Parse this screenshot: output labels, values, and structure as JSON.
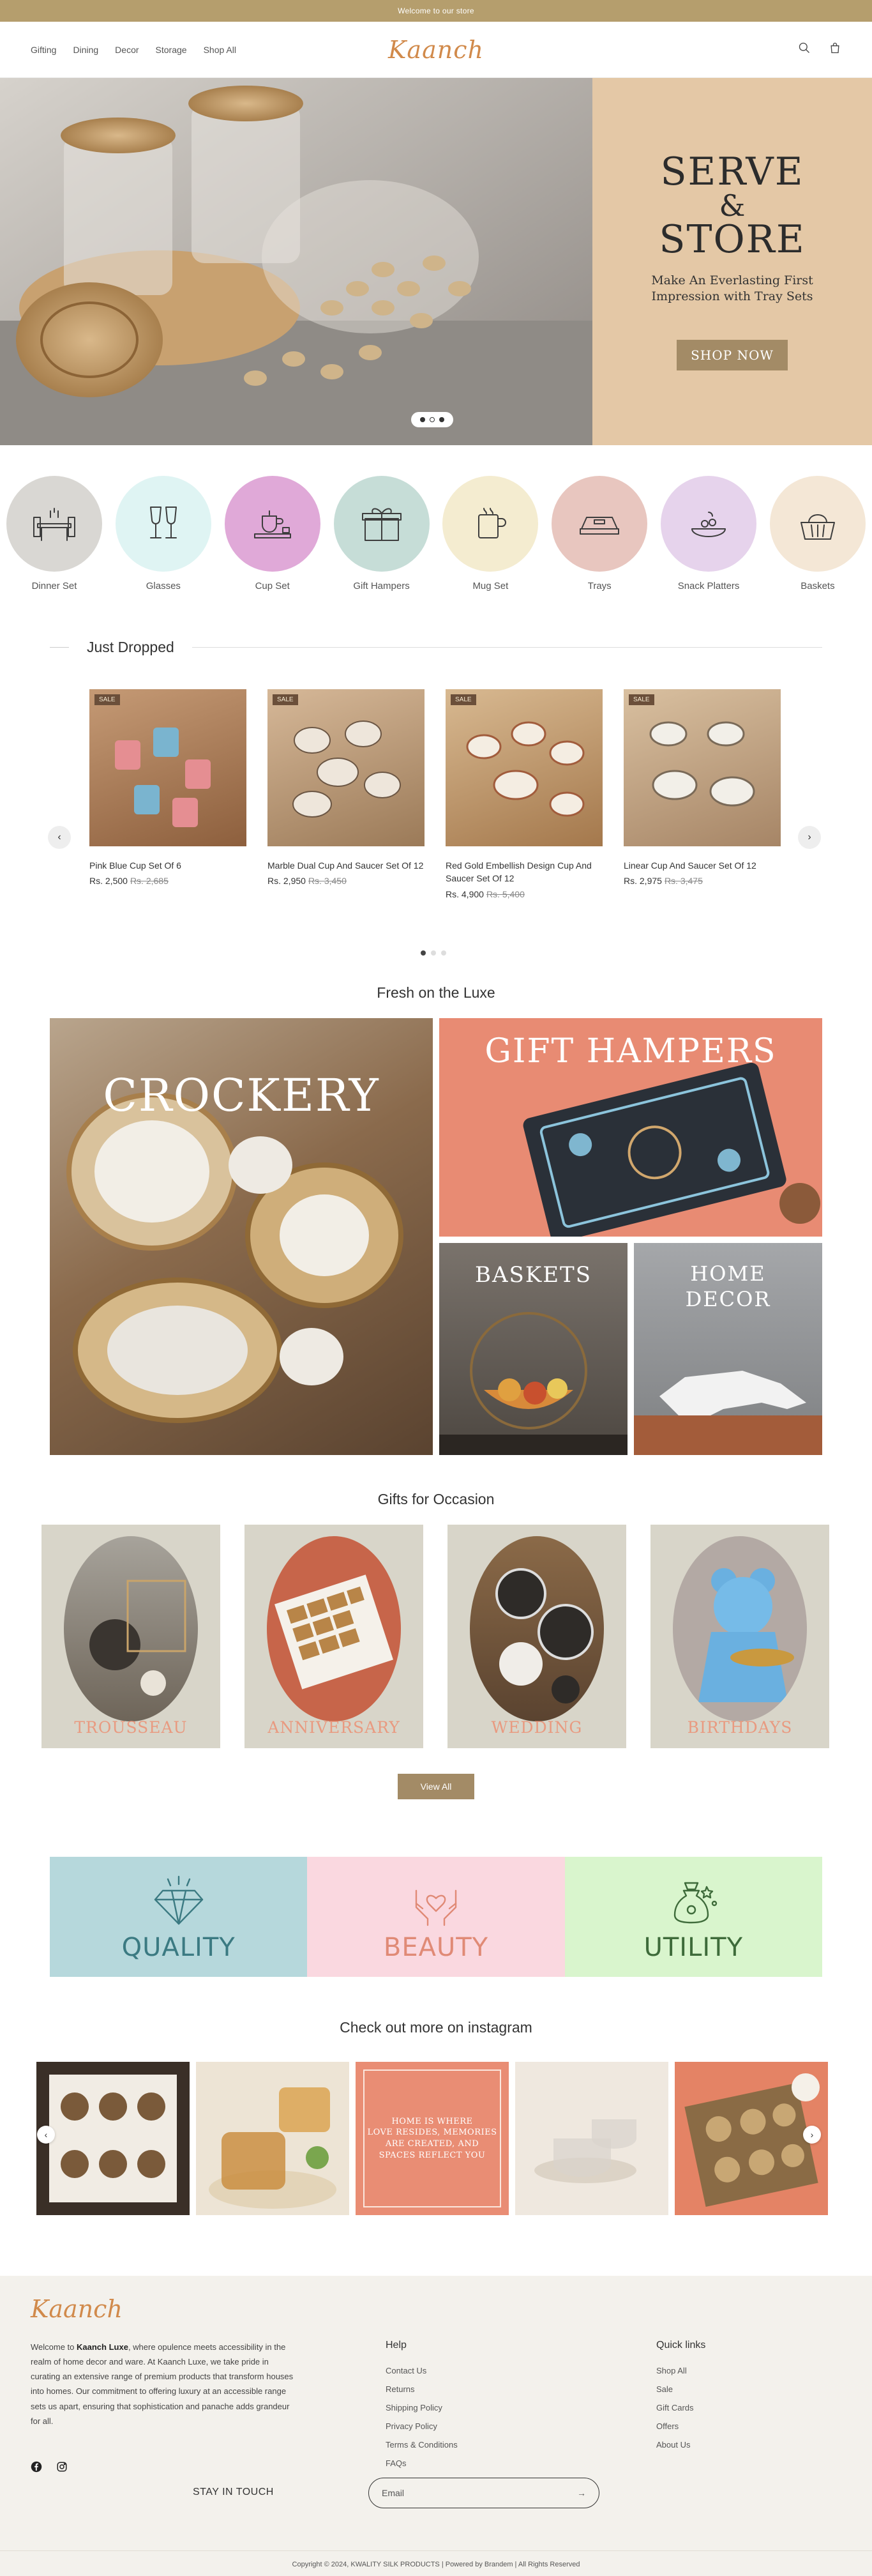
{
  "announcement": "Welcome to our store",
  "header": {
    "nav": [
      "Gifting",
      "Dining",
      "Decor",
      "Storage",
      "Shop All"
    ],
    "logo": "Kaanch",
    "icons": [
      "search-icon",
      "cart-icon"
    ]
  },
  "hero": {
    "title_line1": "SERVE",
    "amp": "&",
    "title_line2": "STORE",
    "subtitle_line1": "Make An Everlasting First",
    "subtitle_line2": "Impression with Tray Sets",
    "button": "SHOP NOW",
    "bg_color": "#e4c8a6"
  },
  "categories": [
    {
      "label": "Dinner Set",
      "color": "#d9d7d3",
      "icon": "dining-table-icon"
    },
    {
      "label": "Glasses",
      "color": "#dff4f3",
      "icon": "wine-glasses-icon"
    },
    {
      "label": "Cup Set",
      "color": "#e0a9d8",
      "icon": "tea-set-icon"
    },
    {
      "label": "Gift Hampers",
      "color": "#c6ddd7",
      "icon": "gift-icon"
    },
    {
      "label": "Mug Set",
      "color": "#f4ecd0",
      "icon": "mug-icon"
    },
    {
      "label": "Trays",
      "color": "#e8c6bf",
      "icon": "tray-icon"
    },
    {
      "label": "Snack Platters",
      "color": "#e6d3ec",
      "icon": "snack-platter-icon"
    },
    {
      "label": "Baskets",
      "color": "#f4e7d6",
      "icon": "basket-icon"
    }
  ],
  "just_dropped": {
    "title": "Just Dropped",
    "products": [
      {
        "name": "Pink Blue Cup Set Of 6",
        "price": "Rs. 2,500",
        "old_price": "Rs. 2,685",
        "badge": "SALE"
      },
      {
        "name": "Marble Dual Cup And Saucer Set Of 12",
        "price": "Rs. 2,950",
        "old_price": "Rs. 3,450",
        "badge": "SALE"
      },
      {
        "name": "Red Gold Embellish Design Cup And Saucer Set Of 12",
        "price": "Rs. 4,900",
        "old_price": "Rs. 5,400",
        "badge": "SALE"
      },
      {
        "name": "Linear Cup And Saucer Set Of 12",
        "price": "Rs. 2,975",
        "old_price": "Rs. 3,475",
        "badge": "SALE"
      }
    ]
  },
  "fresh": {
    "title": "Fresh on the Luxe",
    "crockery": "CROCKERY",
    "hampers": "GIFT HAMPERS",
    "baskets": "BASKETS",
    "home_decor_1": "HOME",
    "home_decor_2": "DECOR"
  },
  "occasions": {
    "title": "Gifts for Occasion",
    "items": [
      "TROUSSEAU",
      "ANNIVERSARY",
      "WEDDING",
      "BIRTHDAYS"
    ],
    "button": "View All"
  },
  "values": [
    {
      "label": "QUALITY",
      "bg": "#b6d8dc",
      "fg": "#3b7a82",
      "icon": "diamond-icon"
    },
    {
      "label": "BEAUTY",
      "bg": "#fad8e0",
      "fg": "#e08a76",
      "icon": "hands-heart-icon"
    },
    {
      "label": "UTILITY",
      "bg": "#d9f5cd",
      "fg": "#3e6b3a",
      "icon": "money-bag-icon"
    }
  ],
  "instagram": {
    "title": "Check out more on instagram",
    "quote_l1": "HOME IS WHERE",
    "quote_l2": "LOVE RESIDES, MEMORIES",
    "quote_l3": "ARE CREATED, AND",
    "quote_l4": "SPACES REFLECT YOU"
  },
  "footer": {
    "logo": "Kaanch",
    "about_pre": "Welcome to ",
    "about_brand": "Kaanch Luxe",
    "about_text": ", where opulence meets accessibility in the realm of home decor and ware. At Kaanch Luxe, we take pride in curating an extensive range of premium products that transform houses into homes. Our commitment to offering luxury at an accessible range sets us apart, ensuring that sophistication and panache adds grandeur for all.",
    "help_title": "Help",
    "help_links": [
      "Contact Us",
      "Returns",
      "Shipping Policy",
      "Privacy Policy",
      "Terms & Conditions",
      "FAQs"
    ],
    "quick_title": "Quick links",
    "quick_links": [
      "Shop All",
      "Sale",
      "Gift Cards",
      "Offers",
      "About Us"
    ],
    "stay": "STAY IN TOUCH",
    "email_placeholder": "Email",
    "copyright": "Copyright © 2024, KWALITY SILK PRODUCTS | Powered by Brandem | All Rights Reserved"
  }
}
